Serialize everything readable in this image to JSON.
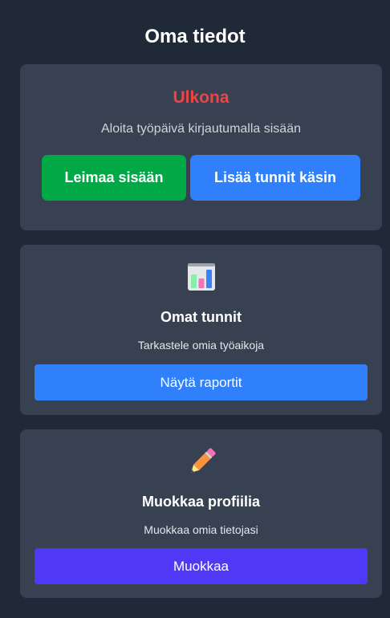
{
  "page": {
    "title": "Oma tiedot"
  },
  "status_card": {
    "status": "Ulkona",
    "subtitle": "Aloita työpäivä kirjautumalla sisään",
    "checkin_label": "Leimaa sisään",
    "manual_label": "Lisää tunnit käsin"
  },
  "hours_card": {
    "icon": "bar-chart-icon",
    "title": "Omat tunnit",
    "description": "Tarkastele omia työaikoja",
    "button_label": "Näytä raportit"
  },
  "profile_card": {
    "icon": "pencil-icon",
    "title": "Muokkaa profiilia",
    "description": "Muokkaa omia tietojasi",
    "button_label": "Muokkaa"
  },
  "colors": {
    "background": "#1f2937",
    "card": "#374151",
    "status_out": "#ef4444",
    "green": "#00a846",
    "blue": "#2f80fa",
    "purple": "#4f39f6"
  }
}
